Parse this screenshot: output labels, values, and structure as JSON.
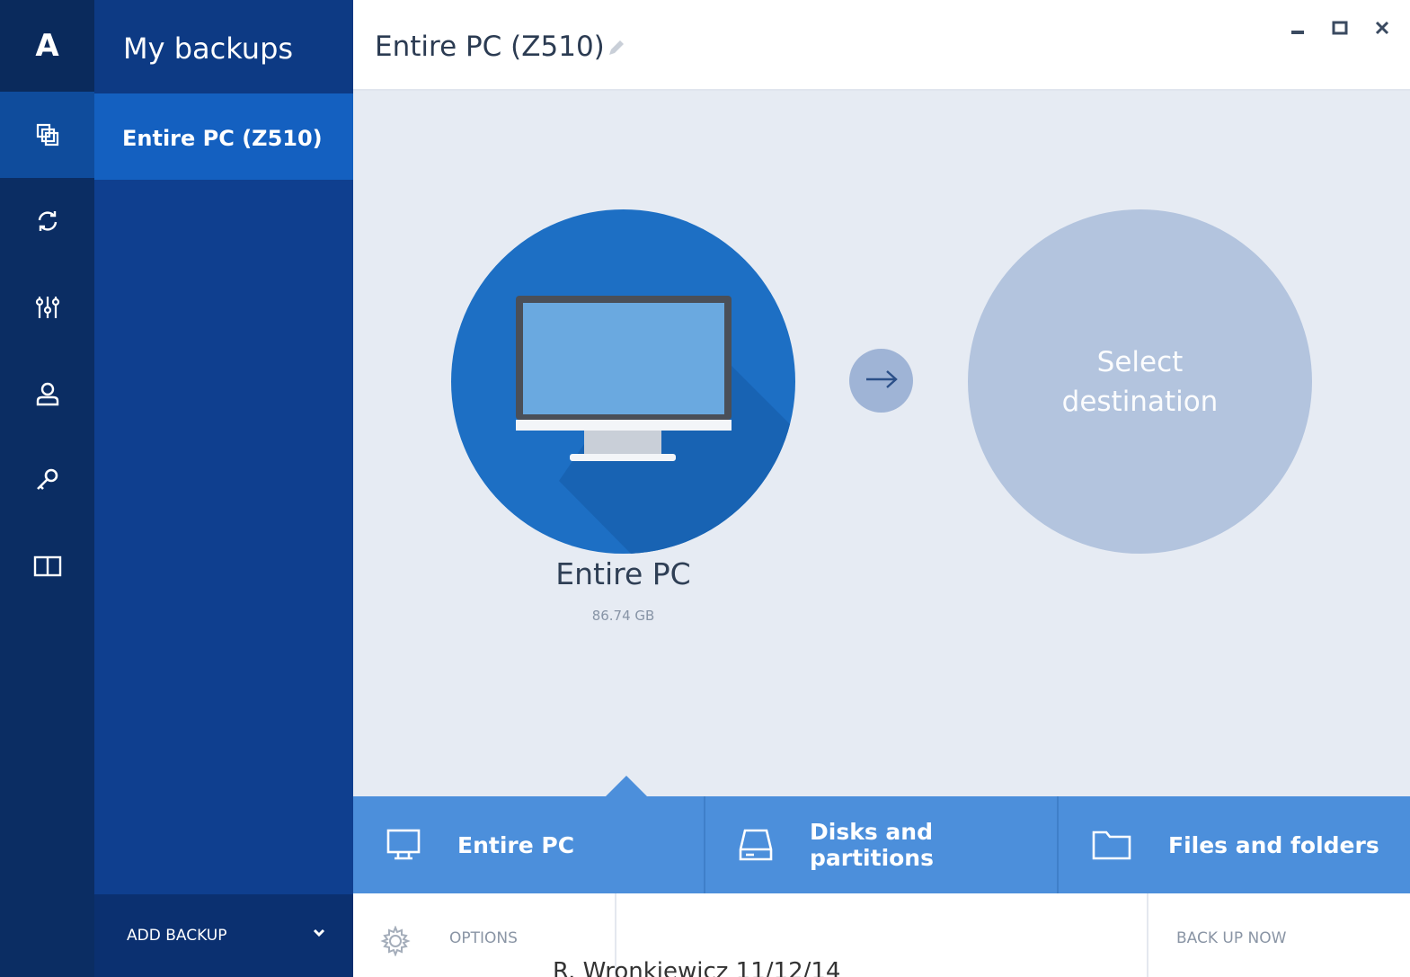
{
  "app": {
    "logo_letter": "A"
  },
  "rail": {
    "items": [
      {
        "icon": "logo-icon"
      },
      {
        "icon": "backup-icon",
        "active": true
      },
      {
        "icon": "sync-icon"
      },
      {
        "icon": "tools-icon"
      },
      {
        "icon": "account-icon"
      },
      {
        "icon": "key-icon"
      },
      {
        "icon": "book-icon"
      }
    ]
  },
  "sidebar": {
    "title": "My backups",
    "items": [
      {
        "label": "Entire PC (Z510)",
        "active": true
      }
    ],
    "add_backup_label": "ADD BACKUP"
  },
  "header": {
    "title": "Entire PC (Z510)"
  },
  "source": {
    "name": "Entire PC",
    "size": "86.74 GB"
  },
  "destination": {
    "label": "Select destination"
  },
  "tabs": [
    {
      "label": "Entire PC",
      "icon": "monitor-icon"
    },
    {
      "label": "Disks and partitions",
      "icon": "disk-icon"
    },
    {
      "label": "Files and folders",
      "icon": "folder-icon"
    }
  ],
  "bottom": {
    "options_label": "OPTIONS",
    "backup_now_label": "BACK UP NOW"
  },
  "footer_note": "R. Wronkiewicz  11/12/14",
  "colors": {
    "rail": "#0b2d63",
    "sidebar": "#0f3f8f",
    "sidebar_active": "#1460c0",
    "accent": "#1d6fc4",
    "tabs": "#4c8fdb",
    "destination": "#b3c4de"
  }
}
